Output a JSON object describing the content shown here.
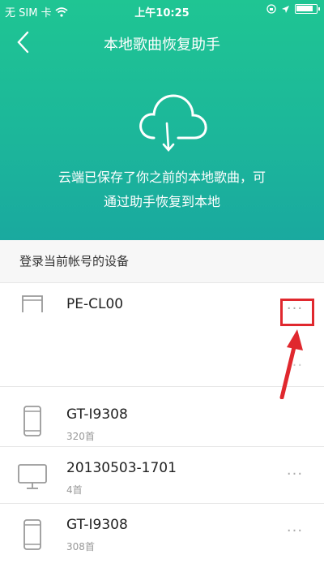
{
  "status_bar": {
    "carrier": "无 SIM 卡",
    "time": "上午10:25"
  },
  "nav": {
    "title": "本地歌曲恢复助手"
  },
  "hero": {
    "line1": "云端已保存了你之前的本地歌曲，可",
    "line2": "通过助手恢复到本地"
  },
  "section": {
    "label": "登录当前帐号的设备"
  },
  "devices": [
    {
      "name": "PE-CL00",
      "count": "",
      "icon": "phone-icon"
    },
    {
      "name": "GT-I9308",
      "count": "320首",
      "icon": "phone-icon"
    },
    {
      "name": "20130503-1701",
      "count": "4首",
      "icon": "desktop-icon"
    },
    {
      "name": "GT-I9308",
      "count": "308首",
      "icon": "phone-icon"
    }
  ],
  "more_label": "···",
  "colors": {
    "header_top": "#1fc593",
    "header_bottom": "#1aa99f",
    "highlight": "#e0282e"
  }
}
